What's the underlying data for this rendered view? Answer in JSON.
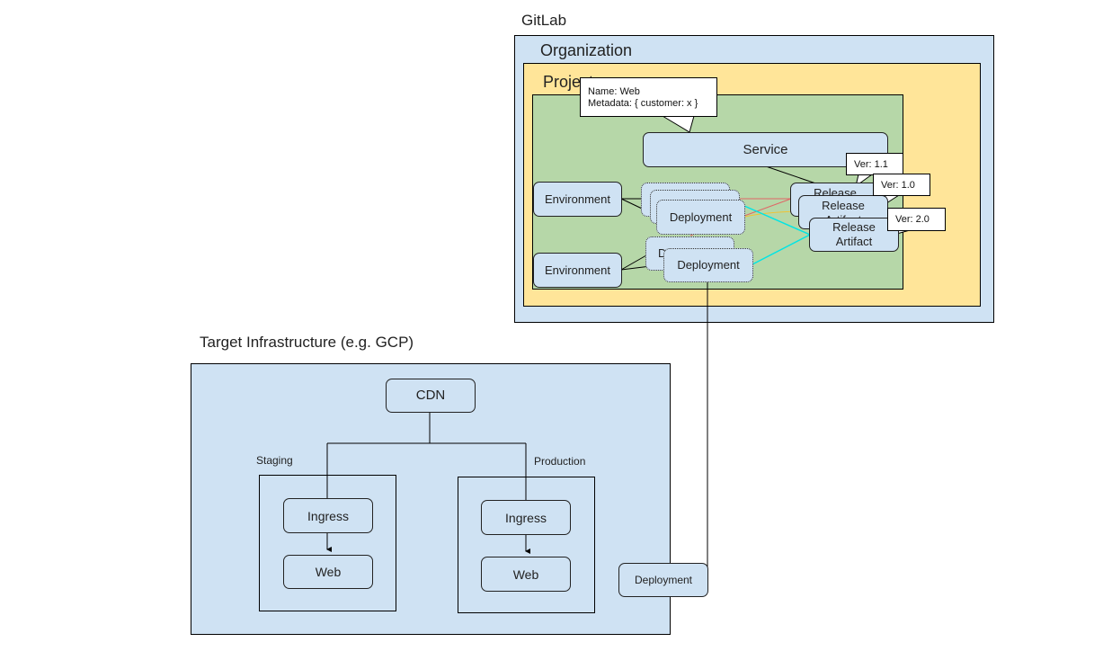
{
  "gitlab": {
    "title": "GitLab",
    "organization": {
      "label": "Organization"
    },
    "project": {
      "label": "Project"
    },
    "service": {
      "label": "Service"
    },
    "service_callout": {
      "line1": "Name: Web",
      "line2": "Metadata: { customer: x }"
    },
    "environments": [
      {
        "label": "Environment"
      },
      {
        "label": "Environment"
      }
    ],
    "deployments": [
      {
        "label": "Deployment"
      },
      {
        "label": "Deployment"
      },
      {
        "label": "Deployment"
      },
      {
        "label": "D"
      },
      {
        "label": "Deployment"
      }
    ],
    "release_artifacts": [
      {
        "label": "Release Artifact",
        "version": "Ver: 1.1"
      },
      {
        "label": "Release Artifact",
        "version": "Ver: 1.0"
      },
      {
        "label": "Release Artifact",
        "version": "Ver: 2.0"
      }
    ]
  },
  "infrastructure": {
    "title": "Target Infrastructure (e.g. GCP)",
    "cdn": {
      "label": "CDN"
    },
    "staging": {
      "label": "Staging",
      "ingress": "Ingress",
      "web": "Web"
    },
    "production": {
      "label": "Production",
      "ingress": "Ingress",
      "web": "Web"
    },
    "deployment": {
      "label": "Deployment"
    }
  },
  "colors": {
    "organization_fill": "#cfe2f3",
    "project_fill": "#ffe599",
    "service_area_fill": "#b6d7a8",
    "node_fill": "#cfe2f3",
    "link_red": "#e06666",
    "link_yellow": "#f1c232",
    "link_cyan": "#00ffff"
  }
}
